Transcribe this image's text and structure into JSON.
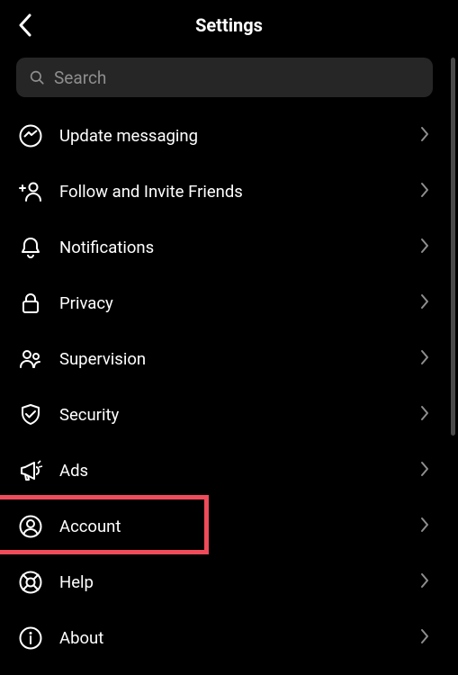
{
  "header": {
    "title": "Settings"
  },
  "search": {
    "placeholder": "Search"
  },
  "items": [
    {
      "id": "update-messaging",
      "label": "Update messaging",
      "icon": "messenger"
    },
    {
      "id": "follow-invite",
      "label": "Follow and Invite Friends",
      "icon": "person-plus"
    },
    {
      "id": "notifications",
      "label": "Notifications",
      "icon": "bell"
    },
    {
      "id": "privacy",
      "label": "Privacy",
      "icon": "lock"
    },
    {
      "id": "supervision",
      "label": "Supervision",
      "icon": "people"
    },
    {
      "id": "security",
      "label": "Security",
      "icon": "shield-check"
    },
    {
      "id": "ads",
      "label": "Ads",
      "icon": "megaphone"
    },
    {
      "id": "account",
      "label": "Account",
      "icon": "user-circle",
      "highlighted": true
    },
    {
      "id": "help",
      "label": "Help",
      "icon": "lifebuoy"
    },
    {
      "id": "about",
      "label": "About",
      "icon": "info"
    }
  ],
  "colors": {
    "highlight": "#ef4b5a",
    "searchBg": "#262626",
    "placeholder": "#8e8e8e",
    "chevron": "#8e8e8e"
  }
}
